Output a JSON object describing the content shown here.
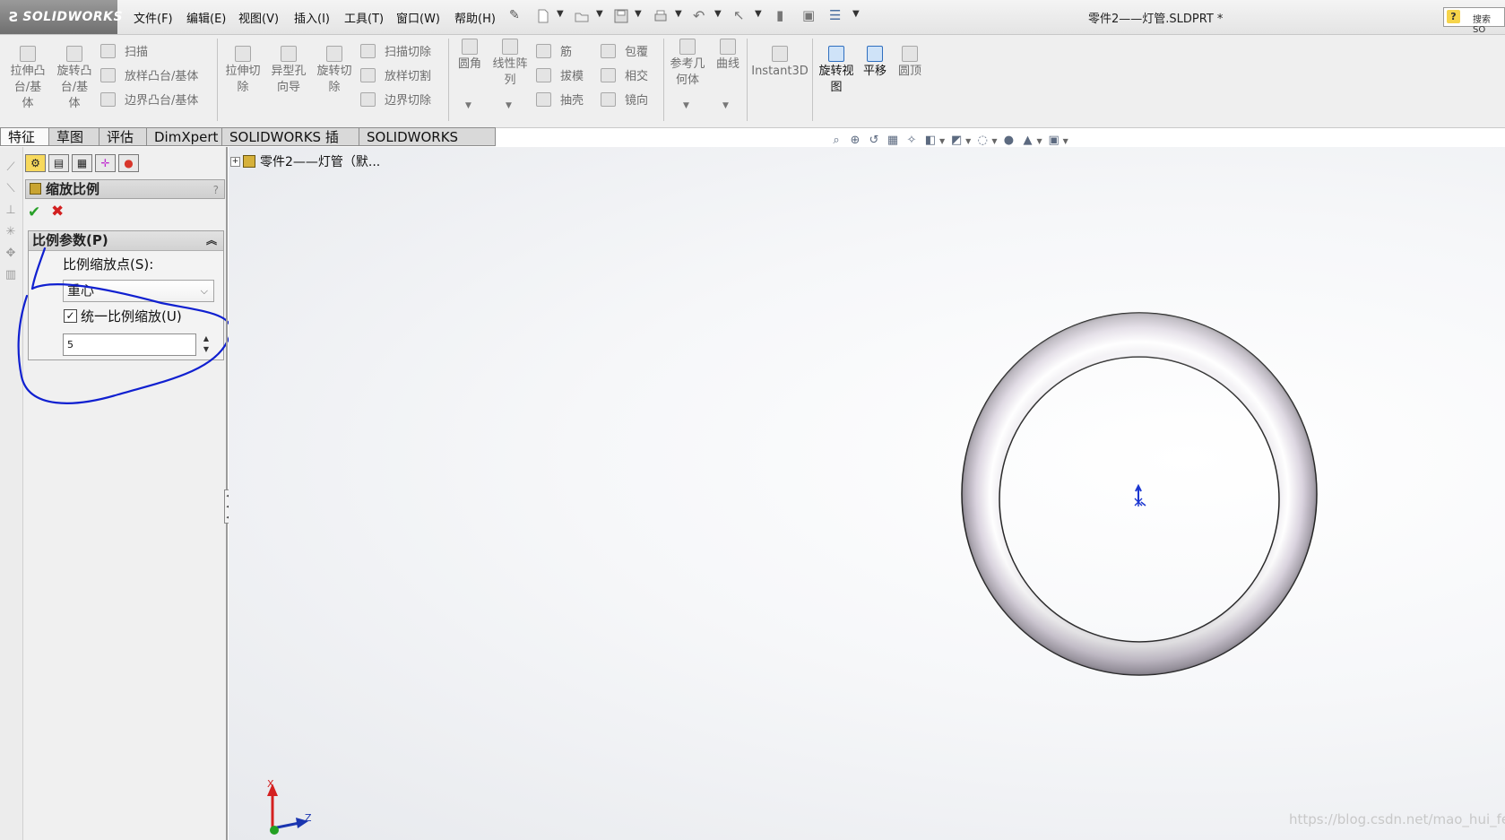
{
  "app": {
    "brand": "SOLIDWORKS",
    "document_title": "零件2——灯管.SLDPRT *"
  },
  "menu": [
    "文件(F)",
    "编辑(E)",
    "视图(V)",
    "插入(I)",
    "工具(T)",
    "窗口(W)",
    "帮助(H)"
  ],
  "help_search": {
    "text": "搜索 SO"
  },
  "ribbon": {
    "extrude_boss": [
      "拉伸凸",
      "台/基",
      "体"
    ],
    "revolve_boss": [
      "旋转凸",
      "台/基",
      "体"
    ],
    "sweep": "扫描",
    "loft_boss": "放样凸台/基体",
    "boundary_boss": "边界凸台/基体",
    "extrude_cut": [
      "拉伸切",
      "除"
    ],
    "hole_wizard": [
      "异型孔",
      "向导"
    ],
    "revolve_cut": [
      "旋转切",
      "除"
    ],
    "sweep_cut": "扫描切除",
    "loft_cut": "放样切割",
    "boundary_cut": "边界切除",
    "fillet": "圆角",
    "linear_pattern": [
      "线性阵",
      "列"
    ],
    "rib": "筋",
    "wrap": "包覆",
    "draft": "拔模",
    "intersect": "相交",
    "shell": "抽壳",
    "mirror": "镜向",
    "reference_geometry": [
      "参考几",
      "何体"
    ],
    "curves": "曲线",
    "instant3d": "Instant3D",
    "rotate_view": [
      "旋转视",
      "图"
    ],
    "pan": "平移",
    "dome": "圆顶"
  },
  "tabs": [
    "特征",
    "草图",
    "评估",
    "DimXpert",
    "SOLIDWORKS 插件",
    "SOLIDWORKS MBD"
  ],
  "property_manager": {
    "title": "缩放比例",
    "group_title": "比例参数(P)",
    "scale_about_label": "比例缩放点(S):",
    "scale_about_value": "重心",
    "uniform_scaling_label": "统一比例缩放(U)",
    "uniform_scaling_checked": true,
    "scale_factor": "5"
  },
  "feature_tree": {
    "root": "零件2——灯管（默..."
  },
  "triad": {
    "x": "X",
    "z": "Z"
  },
  "watermark": "https://blog.csdn.net/mao_hui_fei",
  "colors": {
    "accent_blue": "#2f6fbf",
    "annotation_blue": "#1020d0",
    "ok_green": "#28a028",
    "cancel_red": "#d22020"
  }
}
